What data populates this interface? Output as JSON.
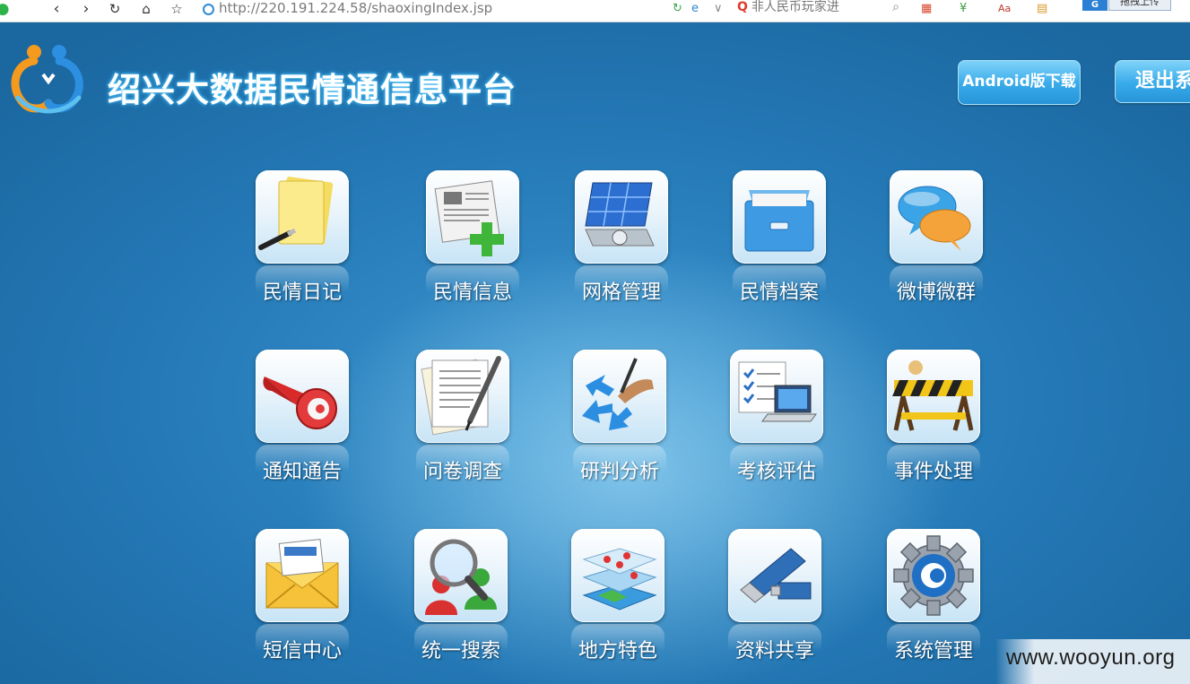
{
  "browser": {
    "url": "http://220.191.224.58/shaoxingIndex.jsp",
    "search_placeholder": "非人民币玩家进",
    "upload_tip": "拖拽上传"
  },
  "header": {
    "title": "绍兴大数据民情通信息平台",
    "android_button": "Android版下载",
    "logout_button": "退出系"
  },
  "tiles": [
    {
      "label": "民情日记",
      "icon": "notepad-icon"
    },
    {
      "label": "民情信息",
      "icon": "newspaper-add-icon"
    },
    {
      "label": "网格管理",
      "icon": "grid-panel-icon"
    },
    {
      "label": "民情档案",
      "icon": "file-cabinet-icon"
    },
    {
      "label": "微博微群",
      "icon": "chat-bubbles-icon"
    },
    {
      "label": "通知通告",
      "icon": "megaphone-icon"
    },
    {
      "label": "问卷调查",
      "icon": "questionnaire-pen-icon"
    },
    {
      "label": "研判分析",
      "icon": "analysis-arrows-icon"
    },
    {
      "label": "考核评估",
      "icon": "laptop-checklist-icon"
    },
    {
      "label": "事件处理",
      "icon": "barrier-icon"
    },
    {
      "label": "短信中心",
      "icon": "envelope-icon"
    },
    {
      "label": "统一搜索",
      "icon": "magnifier-users-icon"
    },
    {
      "label": "地方特色",
      "icon": "map-layers-icon"
    },
    {
      "label": "资料共享",
      "icon": "usb-drive-icon"
    },
    {
      "label": "系统管理",
      "icon": "gear-icon"
    }
  ],
  "watermark": "www.wooyun.org"
}
